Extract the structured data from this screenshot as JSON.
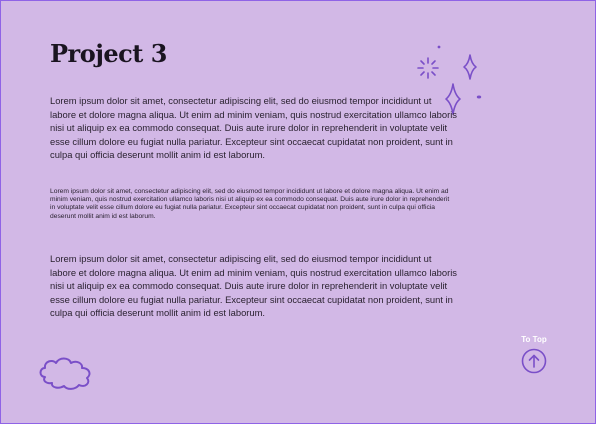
{
  "page": {
    "title": "Project 3",
    "background_color": "#d2b8e6",
    "border_color": "#8f63e6",
    "accent_color": "#7a4fc8"
  },
  "paragraphs": [
    "Lorem ipsum dolor sit amet, consectetur adipiscing elit, sed do eiusmod tempor incididunt ut labore et dolore magna aliqua. Ut enim ad minim veniam, quis nostrud exercitation ullamco laboris nisi ut aliquip ex ea commodo consequat. Duis aute irure dolor in reprehenderit in voluptate velit esse cillum dolore eu fugiat nulla pariatur. Excepteur sint occaecat cupidatat non proident, sunt in culpa qui officia deserunt mollit anim id est laborum.",
    "Lorem ipsum dolor sit amet, consectetur adipiscing elit, sed do eiusmod tempor incididunt ut labore et dolore magna aliqua. Ut enim ad minim veniam, quis nostrud exercitation ullamco laboris nisi ut aliquip ex ea commodo consequat. Duis aute irure dolor in reprehenderit in voluptate velit esse cillum dolore eu fugiat nulla pariatur. Excepteur sint occaecat cupidatat non proident, sunt in culpa qui officia deserunt mollit anim id est laborum.",
    "Lorem ipsum dolor sit amet, consectetur adipiscing elit, sed do eiusmod tempor incididunt ut labore et dolore magna aliqua. Ut enim ad minim veniam, quis nostrud exercitation ullamco laboris nisi ut aliquip ex ea commodo consequat. Duis aute irure dolor in reprehenderit in voluptate velit esse cillum dolore eu fugiat nulla pariatur. Excepteur sint occaecat cupidatat non proident, sunt in culpa qui officia deserunt mollit anim id est laborum."
  ],
  "to_top": {
    "label": "To Top",
    "icon": "arrow-up-circle-icon"
  },
  "decorations": {
    "sparkles_icon": "sparkles-icon",
    "cloud_icon": "cloud-icon"
  }
}
